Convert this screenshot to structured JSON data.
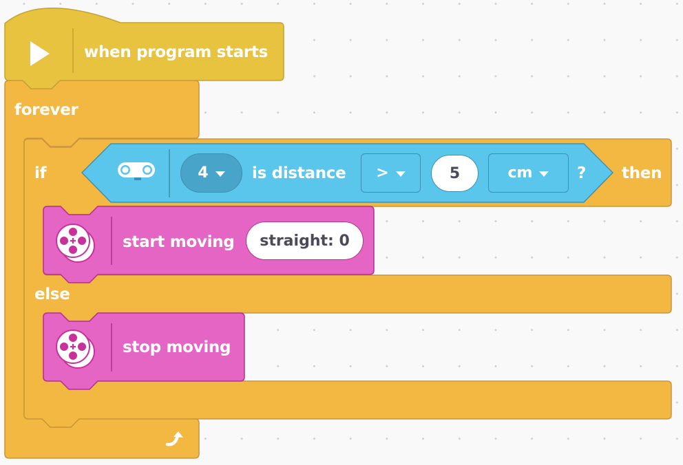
{
  "canvas": {
    "background_color": "#f9f9f9",
    "grid_dot_color": "#cfcfcf"
  },
  "colors": {
    "event_yellow": "#e8c33f",
    "control_orange": "#f3b841",
    "sensor_blue": "#5bc6ec",
    "motor_pink": "#e565c5",
    "motor_pink_dark": "#c8309a"
  },
  "blocks": {
    "hat": {
      "icon": "play-icon",
      "label": "when program starts"
    },
    "forever": {
      "label": "forever",
      "loop_icon": "loop-arrow-icon"
    },
    "if_else": {
      "if_label": "if",
      "then_label": "then",
      "else_label": "else",
      "condition": {
        "sensor_icon": "distance-sensor-icon",
        "port": "4",
        "label": "is distance",
        "operator": ">",
        "value": "5",
        "unit": "cm",
        "question": "?"
      }
    },
    "start_moving": {
      "icon": "motor-wheel-icon",
      "label": "start moving",
      "direction_value": "straight: 0"
    },
    "stop_moving": {
      "icon": "motor-wheel-icon",
      "label": "stop moving"
    }
  }
}
